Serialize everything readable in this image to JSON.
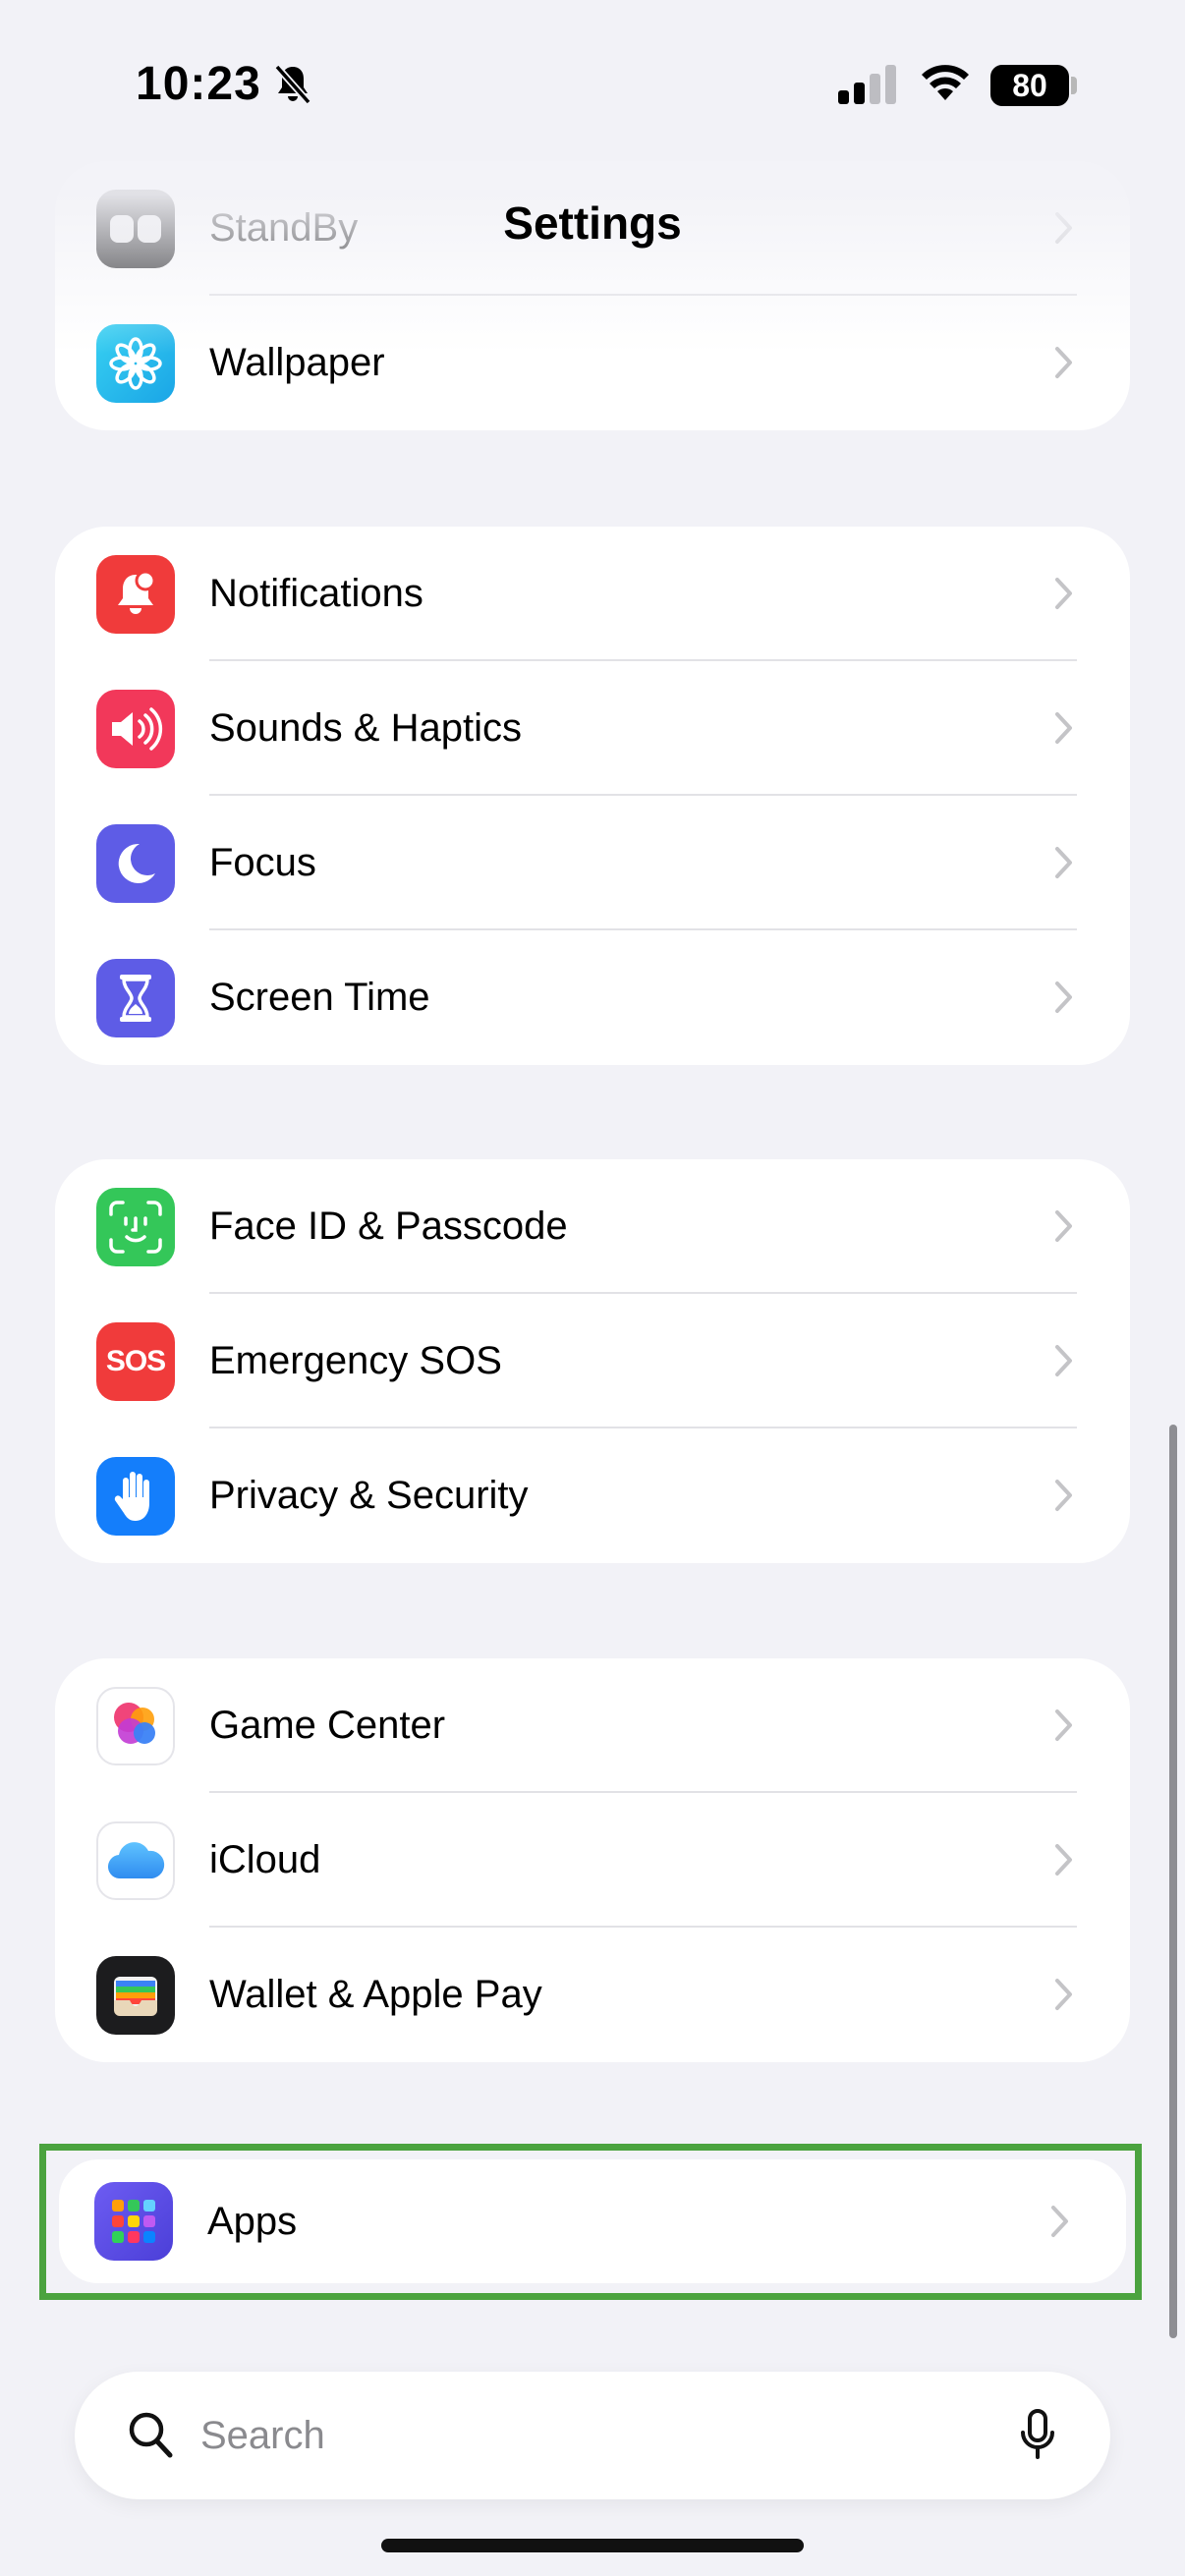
{
  "status_bar": {
    "time": "10:23",
    "battery": "80"
  },
  "nav": {
    "title": "Settings"
  },
  "groups": [
    {
      "items": [
        {
          "label": "StandBy"
        },
        {
          "label": "Wallpaper"
        }
      ]
    },
    {
      "items": [
        {
          "label": "Notifications"
        },
        {
          "label": "Sounds & Haptics"
        },
        {
          "label": "Focus"
        },
        {
          "label": "Screen Time"
        }
      ]
    },
    {
      "items": [
        {
          "label": "Face ID & Passcode"
        },
        {
          "label": "Emergency SOS",
          "icon_text": "SOS"
        },
        {
          "label": "Privacy & Security"
        }
      ]
    },
    {
      "items": [
        {
          "label": "Game Center"
        },
        {
          "label": "iCloud"
        },
        {
          "label": "Wallet & Apple Pay"
        }
      ]
    },
    {
      "items": [
        {
          "label": "Apps"
        }
      ]
    }
  ],
  "search": {
    "placeholder": "Search"
  },
  "colors": {
    "highlight": "#4ba33f",
    "background": "#f2f2f7"
  }
}
